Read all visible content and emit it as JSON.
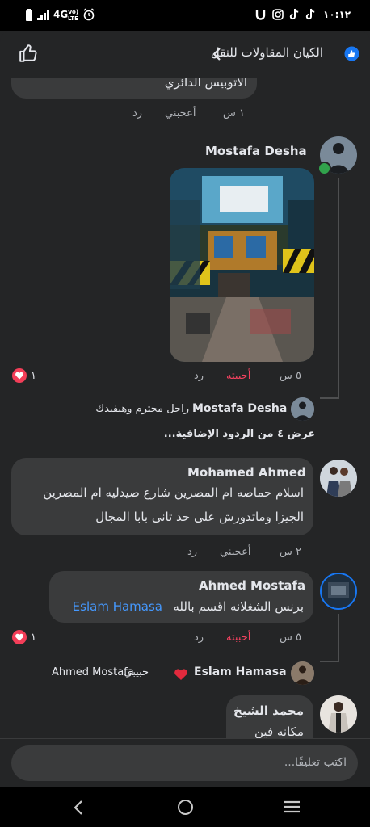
{
  "status_bar": {
    "time": "١٠:١٢",
    "network": "4G",
    "volte": "Vo) LTE"
  },
  "header": {
    "group_name": "الكيان المقاولات للنقل"
  },
  "comments": {
    "prev": {
      "text": "الاتوبيس الدائري",
      "time": "١ س",
      "like": "أعجبني",
      "reply": "رد"
    },
    "c1": {
      "author": "Mostafa Desha",
      "time": "٥ س",
      "like": "أحببته",
      "reply": "رد",
      "reaction_count": "١",
      "reply_preview": {
        "author": "Mostafa Desha",
        "text": "راجل محترم وهيفيدك"
      },
      "more_replies": "عرض ٤ من الردود الإضافية..."
    },
    "c2": {
      "author": "Mohamed Ahmed",
      "line1": "اسلام حماصه ام المصرين شارع صيدليه ام المصرين",
      "line2": "الجيزا وماتدورش على حد تانى بابا المجال",
      "time": "٢ س",
      "like": "أعجبني",
      "reply": "رد"
    },
    "c3": {
      "author": "Ahmed Mostafa",
      "text": "برنس الشغلانه اقسم بالله",
      "mention": "Eslam Hamasa",
      "time": "٥ س",
      "like": "أحببته",
      "reply": "رد",
      "reaction_count": "١",
      "reply_preview": {
        "author": "Eslam Hamasa",
        "text": "حبيبي",
        "mention": "Ahmed Mostafa"
      }
    },
    "c4": {
      "author": "محمد الشيخ",
      "text": "مكانه فين"
    }
  },
  "input": {
    "placeholder": "اكتب تعليقًا..."
  },
  "colors": {
    "background": "#242526",
    "bubble": "#3a3b3c",
    "link": "#4599ff",
    "love": "#f3425f",
    "online": "#31a24c"
  },
  "icons": [
    "thumbs-up-icon",
    "chevron-left-icon",
    "verified-badge-icon",
    "heart-icon",
    "back-nav-icon",
    "home-nav-icon",
    "recents-nav-icon"
  ]
}
